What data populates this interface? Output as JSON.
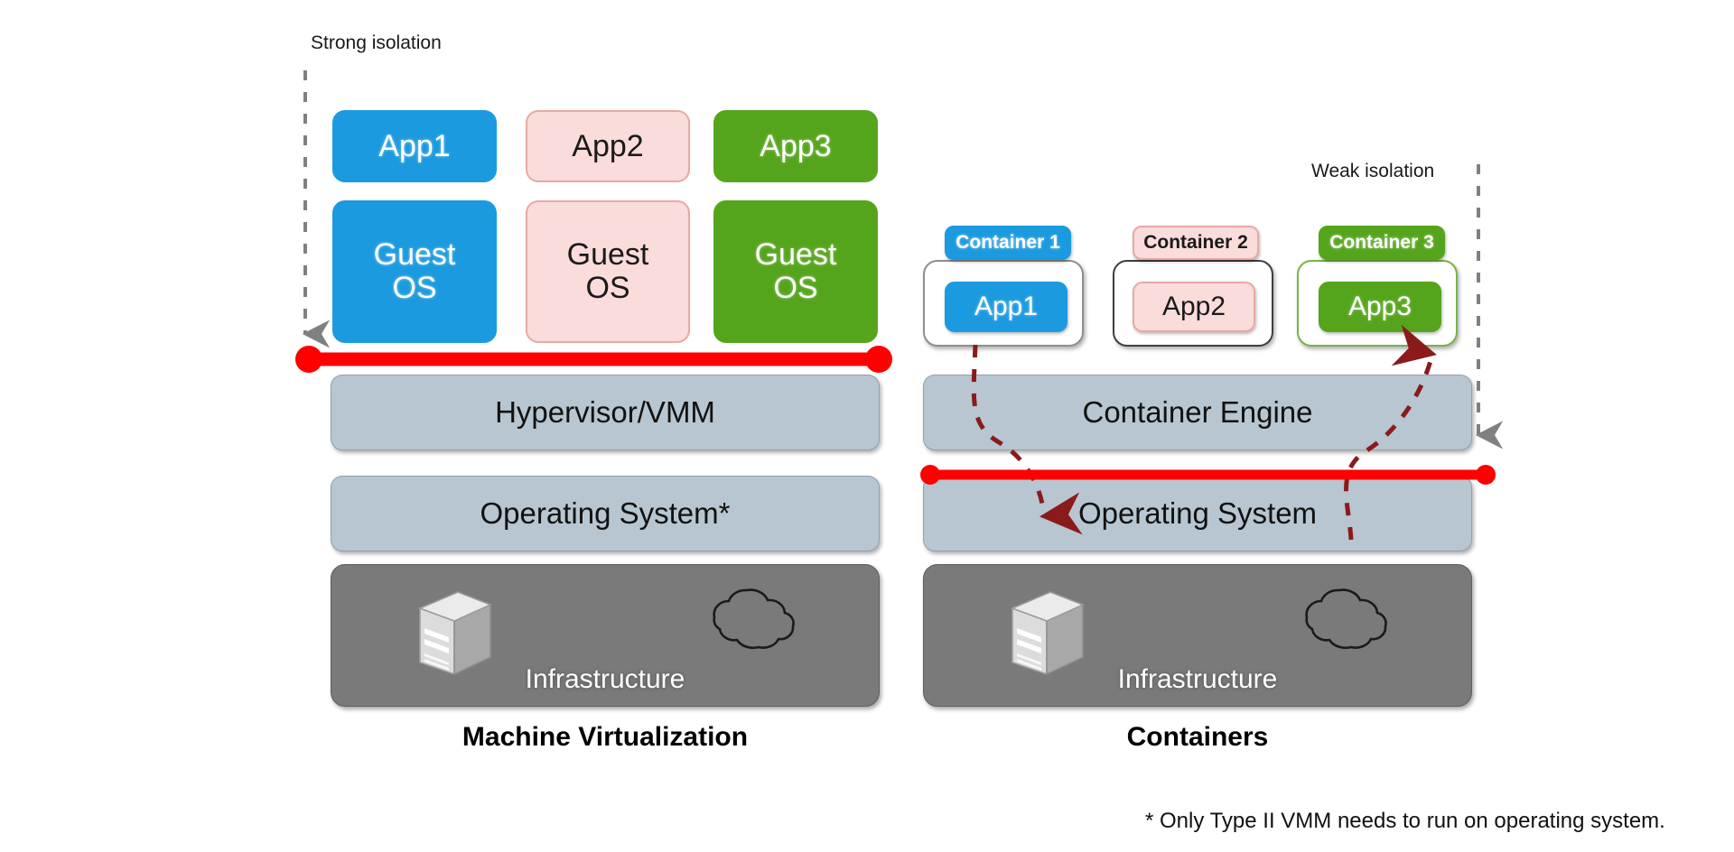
{
  "diagram": {
    "title_left": "Machine Virtualization",
    "title_right": "Containers",
    "footnote": "* Only Type II VMM needs to run on operating system.",
    "colors": {
      "blue": "#1b9ae0",
      "pink": "#fadcda",
      "green": "#55a51c",
      "layer_grey": "#b7c6d0",
      "infrastructure_grey": "#7a7a7a",
      "isolation_line_red": "#ff0000",
      "breach_arrow_darkred": "#8b1a1a",
      "isolation_arrow_grey": "#808080"
    }
  },
  "left_stack": {
    "isolation_label": "Strong isolation",
    "apps": [
      {
        "label": "App1",
        "variant": "blue"
      },
      {
        "label": "App2",
        "variant": "pink"
      },
      {
        "label": "App3",
        "variant": "green"
      }
    ],
    "guest_os": [
      {
        "label": "Guest\nOS",
        "variant": "blue"
      },
      {
        "label": "Guest\nOS",
        "variant": "pink"
      },
      {
        "label": "Guest\nOS",
        "variant": "green"
      }
    ],
    "layers": [
      {
        "label": "Hypervisor/VMM"
      },
      {
        "label": "Operating System*"
      }
    ],
    "infrastructure_label": "Infrastructure",
    "caption": "Machine Virtualization"
  },
  "right_stack": {
    "isolation_label": "Weak isolation",
    "containers": [
      {
        "tab": "Container 1",
        "app": "App1",
        "variant": "blue"
      },
      {
        "tab": "Container 2",
        "app": "App2",
        "variant": "pink"
      },
      {
        "tab": "Container 3",
        "app": "App3",
        "variant": "green"
      }
    ],
    "layers": [
      {
        "label": "Container Engine"
      },
      {
        "label": "Operating System"
      }
    ],
    "infrastructure_label": "Infrastructure",
    "caption": "Containers"
  },
  "icons": {
    "server": "server-icon",
    "cloud": "cloud-icon",
    "isolation_arrow": "dashed-arrow-down-icon",
    "breach_arrow_down": "dashed-breach-arrow-down-icon",
    "breach_arrow_up": "dashed-breach-arrow-up-icon"
  }
}
